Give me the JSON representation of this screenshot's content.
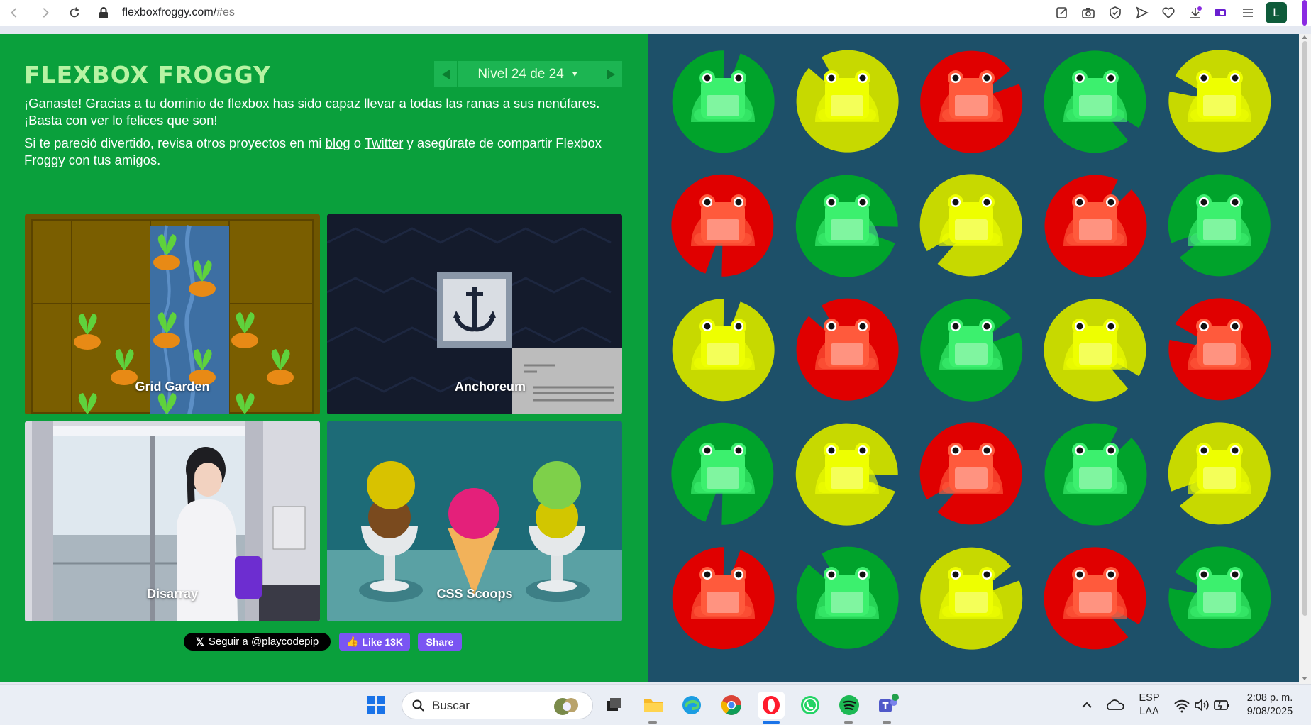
{
  "browser": {
    "url_host": "flexboxfroggy.com/",
    "url_hash": "#es",
    "profile_initial": "L"
  },
  "game": {
    "logo": "FLEXBOX FROGGY",
    "level_label": "Nivel 24 de 24",
    "para1": "¡Ganaste! Gracias a tu dominio de flexbox has sido capaz llevar a todas las ranas a sus nenúfares. ¡Basta con ver lo felices que son!",
    "para2_before": "Si te pareció divertido, revisa otros proyectos en mi ",
    "link_blog": "blog",
    "para2_mid": " o ",
    "link_twitter": "Twitter",
    "para2_after": " y asegúrate de compartir Flexbox Froggy con tus amigos.",
    "projects": [
      {
        "label": "Grid Garden"
      },
      {
        "label": "Anchoreum"
      },
      {
        "label": "Disarray"
      },
      {
        "label": "CSS Scoops"
      }
    ],
    "social": {
      "follow": "Seguir a @playcodepip",
      "like": "Like 13K",
      "share": "Share"
    },
    "frog_grid": [
      [
        "green",
        "yellow",
        "red",
        "green",
        "yellow"
      ],
      [
        "red",
        "green",
        "yellow",
        "red",
        "green"
      ],
      [
        "yellow",
        "red",
        "green",
        "yellow",
        "red"
      ],
      [
        "green",
        "yellow",
        "red",
        "green",
        "yellow"
      ],
      [
        "red",
        "green",
        "yellow",
        "red",
        "green"
      ]
    ]
  },
  "colors": {
    "green_pad": "#00a32b",
    "green_frog": "#3cf06e",
    "yellow_pad": "#c7d900",
    "yellow_frog": "#eeff00",
    "red_pad": "#e00000",
    "red_frog": "#ff5a3c"
  },
  "taskbar": {
    "search_placeholder": "Buscar",
    "lang_top": "ESP",
    "lang_bottom": "LAA",
    "time": "2:08 p. m.",
    "date": "9/08/2025"
  }
}
